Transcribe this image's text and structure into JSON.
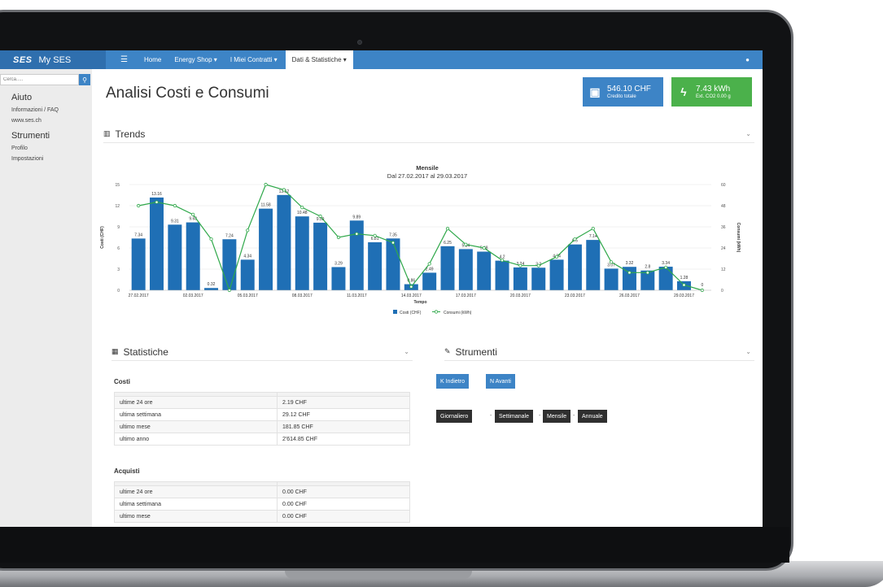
{
  "nav": {
    "logo": "SES",
    "brand": "My SES",
    "menu_icon": "hamburger-menu-icon",
    "items": [
      {
        "label": "Home"
      },
      {
        "label": "Energy Shop ▾"
      },
      {
        "label": "I Miei Contratti ▾"
      },
      {
        "label": "Dati & Statistiche ▾"
      }
    ],
    "user_icon": "user-icon"
  },
  "sidebar": {
    "search_placeholder": "Cerca.....",
    "search_icon": "search-icon",
    "section1": "Aiuto",
    "links1": [
      "Informazioni / FAQ",
      "www.ses.ch"
    ],
    "section2": "Strumenti",
    "links2": [
      "Profilo",
      "Impostazioni"
    ]
  },
  "page": {
    "title": "Analisi Costi e Consumi",
    "credit_value": "546.10 CHF",
    "credit_label": "Credito totale",
    "energy_value": "7.43 kWh",
    "energy_label": "Ext. CO2 0.00 g",
    "credit_icon": "money-icon",
    "energy_icon": "lightning-icon"
  },
  "trends": {
    "title": "Trends",
    "icon": "bar-chart-icon"
  },
  "chart_data": {
    "type": "bar",
    "title": "Mensile",
    "subtitle": "Dal 27.02.2017 al 29.03.2017",
    "xlabel": "Tempo",
    "ylabel": "Costi (CHF)",
    "y2label": "Consumi (kWh)",
    "ylim": [
      0,
      15
    ],
    "y2lim": [
      0,
      60
    ],
    "yticks": [
      0,
      3,
      6,
      9,
      12,
      15
    ],
    "y2ticks": [
      0,
      12,
      24,
      36,
      48,
      60
    ],
    "xtick_labels": [
      "27.02.2017",
      "02.03.2017",
      "05.03.2017",
      "08.03.2017",
      "11.03.2017",
      "14.03.2017",
      "17.03.2017",
      "20.03.2017",
      "23.03.2017",
      "26.03.2017",
      "29.03.2017"
    ],
    "xtick_positions": [
      0,
      3,
      6,
      9,
      12,
      15,
      18,
      21,
      24,
      27,
      30
    ],
    "grid": true,
    "legend": "bottom-center",
    "series": [
      {
        "name": "Costi (CHF)",
        "type": "bar",
        "color": "#1f6fb5",
        "values": [
          7.34,
          13.16,
          9.31,
          9.63,
          0.32,
          7.24,
          4.34,
          11.58,
          13.52,
          10.48,
          9.59,
          3.29,
          9.89,
          6.81,
          7.35,
          0.86,
          2.49,
          6.25,
          5.84,
          5.48,
          4.2,
          3.24,
          3.2,
          4.34,
          6.5,
          7.14,
          3.07,
          3.32,
          2.8,
          3.34,
          1.28,
          0
        ]
      },
      {
        "name": "Consumi (kWh)",
        "type": "line",
        "color": "#2fa84a",
        "values": [
          48,
          50,
          48,
          43,
          29,
          0,
          34,
          60,
          57,
          47,
          42,
          30,
          32,
          31,
          27,
          2,
          15,
          35,
          26,
          24,
          17,
          14,
          14,
          19,
          29,
          35,
          16,
          10,
          10,
          13,
          3,
          0
        ]
      }
    ]
  },
  "statistiche": {
    "title": "Statistiche",
    "icon": "image-icon",
    "costi_title": "Costi",
    "costi_rows": [
      {
        "label": "ultime 24 ore",
        "value": "2.19 CHF"
      },
      {
        "label": "ultima settimana",
        "value": "29.12 CHF"
      },
      {
        "label": "ultimo mese",
        "value": "181.85 CHF"
      },
      {
        "label": "ultimo anno",
        "value": "2'614.85 CHF"
      }
    ],
    "acquisti_title": "Acquisti",
    "acquisti_rows": [
      {
        "label": "ultime 24 ore",
        "value": "0.00 CHF"
      },
      {
        "label": "ultima settimana",
        "value": "0.00 CHF"
      },
      {
        "label": "ultimo mese",
        "value": "0.00 CHF"
      }
    ]
  },
  "strumenti": {
    "title": "Strumenti",
    "icon": "wrench-icon",
    "back_label": "K Indietro",
    "forward_label": "N Avanti",
    "periods": [
      "Giornaliero",
      "Settimanale",
      "Mensile",
      "Annuale"
    ],
    "separator": "-"
  }
}
